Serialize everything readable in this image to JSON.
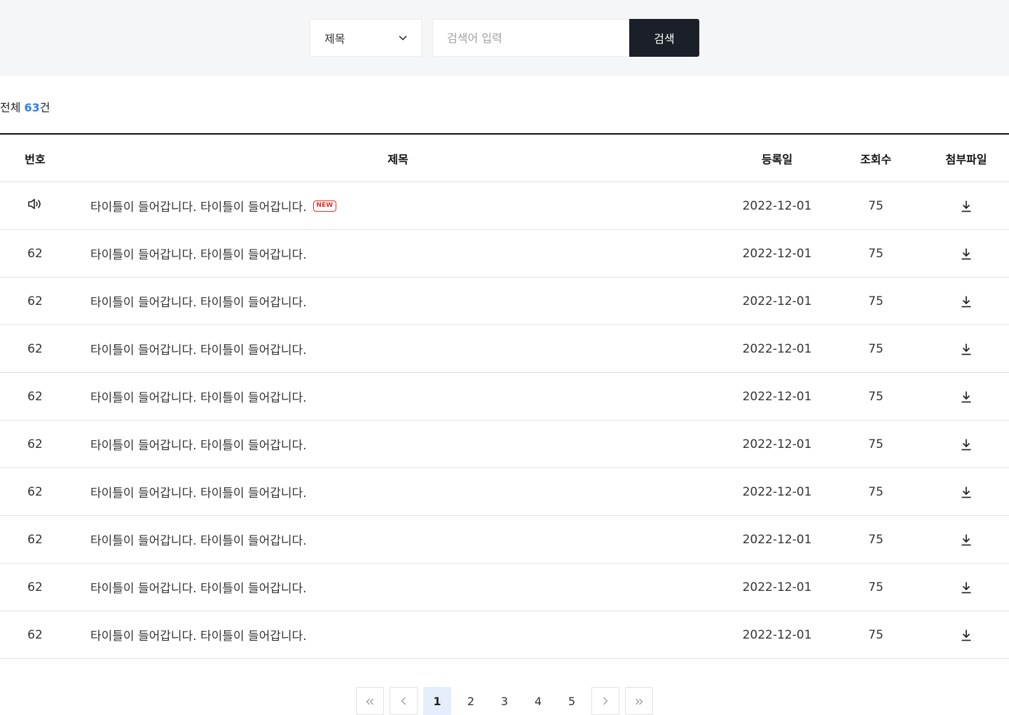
{
  "search": {
    "select_value": "제목",
    "placeholder": "검색어 입력",
    "button_label": "검색"
  },
  "summary": {
    "prefix": "전체 ",
    "count": "63",
    "suffix": "건"
  },
  "table": {
    "headers": {
      "no": "번호",
      "title": "제목",
      "date": "등록일",
      "views": "조회수",
      "file": "첨부파일"
    },
    "rows": [
      {
        "no": "",
        "notice": true,
        "title": "타이틀이 들어갑니다. 타이틀이 들어갑니다.",
        "badge": "NEW",
        "date": "2022-12-01",
        "views": "75"
      },
      {
        "no": "62",
        "title": "타이틀이 들어갑니다. 타이틀이 들어갑니다.",
        "date": "2022-12-01",
        "views": "75"
      },
      {
        "no": "62",
        "title": "타이틀이 들어갑니다. 타이틀이 들어갑니다.",
        "date": "2022-12-01",
        "views": "75"
      },
      {
        "no": "62",
        "title": "타이틀이 들어갑니다. 타이틀이 들어갑니다.",
        "date": "2022-12-01",
        "views": "75"
      },
      {
        "no": "62",
        "title": "타이틀이 들어갑니다. 타이틀이 들어갑니다.",
        "date": "2022-12-01",
        "views": "75"
      },
      {
        "no": "62",
        "title": "타이틀이 들어갑니다. 타이틀이 들어갑니다.",
        "date": "2022-12-01",
        "views": "75"
      },
      {
        "no": "62",
        "title": "타이틀이 들어갑니다. 타이틀이 들어갑니다.",
        "date": "2022-12-01",
        "views": "75"
      },
      {
        "no": "62",
        "title": "타이틀이 들어갑니다. 타이틀이 들어갑니다.",
        "date": "2022-12-01",
        "views": "75"
      },
      {
        "no": "62",
        "title": "타이틀이 들어갑니다. 타이틀이 들어갑니다.",
        "date": "2022-12-01",
        "views": "75"
      },
      {
        "no": "62",
        "title": "타이틀이 들어갑니다. 타이틀이 들어갑니다.",
        "date": "2022-12-01",
        "views": "75"
      }
    ]
  },
  "pagination": {
    "pages": [
      "1",
      "2",
      "3",
      "4",
      "5"
    ],
    "current": "1"
  },
  "icons": {
    "notice": "speaker-icon",
    "download": "download-icon",
    "select": "chevron-down-icon",
    "first": "double-chevron-left-icon",
    "prev": "chevron-left-icon",
    "next": "chevron-right-icon",
    "last": "double-chevron-right-icon"
  },
  "colors": {
    "accent": "#2f80ed",
    "button": "#1b1f28",
    "badge": "#d93025",
    "active_page": "#e6eefb"
  }
}
